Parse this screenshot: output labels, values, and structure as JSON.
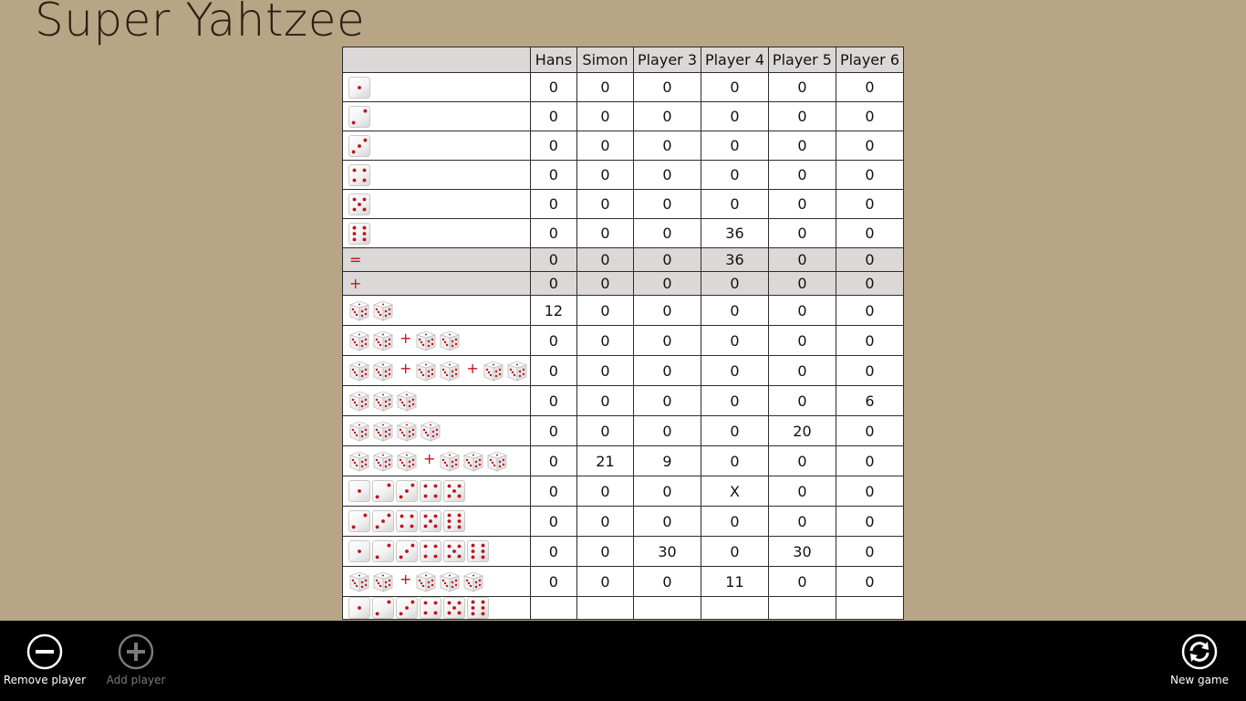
{
  "app": {
    "title": "Super Yahtzee"
  },
  "columns": [
    "Hans",
    "Simon",
    "Player 3",
    "Player 4",
    "Player 5",
    "Player 6"
  ],
  "rows": [
    {
      "category": "ones-die",
      "values": [
        "0",
        "0",
        "0",
        "0",
        "0",
        "0"
      ]
    },
    {
      "category": "twos-die",
      "values": [
        "0",
        "0",
        "0",
        "0",
        "0",
        "0"
      ]
    },
    {
      "category": "threes-die",
      "values": [
        "0",
        "0",
        "0",
        "0",
        "0",
        "0"
      ]
    },
    {
      "category": "fours-die",
      "values": [
        "0",
        "0",
        "0",
        "0",
        "0",
        "0"
      ]
    },
    {
      "category": "fives-die",
      "values": [
        "0",
        "0",
        "0",
        "0",
        "0",
        "0"
      ]
    },
    {
      "category": "sixes-die",
      "values": [
        "0",
        "0",
        "0",
        "36",
        "0",
        "0"
      ]
    },
    {
      "category": "upper-sum",
      "symbol": "=",
      "gray": true,
      "values": [
        "0",
        "0",
        "0",
        "36",
        "0",
        "0"
      ]
    },
    {
      "category": "bonus",
      "symbol": "+",
      "gray": true,
      "values": [
        "0",
        "0",
        "0",
        "0",
        "0",
        "0"
      ]
    },
    {
      "category": "one-pair",
      "values": [
        "12",
        "0",
        "0",
        "0",
        "0",
        "0"
      ]
    },
    {
      "category": "two-pairs",
      "values": [
        "0",
        "0",
        "0",
        "0",
        "0",
        "0"
      ]
    },
    {
      "category": "three-pairs",
      "values": [
        "0",
        "0",
        "0",
        "0",
        "0",
        "0"
      ]
    },
    {
      "category": "three-of-a-kind",
      "values": [
        "0",
        "0",
        "0",
        "0",
        "0",
        "6"
      ]
    },
    {
      "category": "four-of-a-kind",
      "values": [
        "0",
        "0",
        "0",
        "0",
        "20",
        "0"
      ]
    },
    {
      "category": "two-times-three",
      "values": [
        "0",
        "21",
        "9",
        "0",
        "0",
        "0"
      ]
    },
    {
      "category": "small-straight",
      "values": [
        "0",
        "0",
        "0",
        "X",
        "0",
        "0"
      ]
    },
    {
      "category": "large-straight",
      "values": [
        "0",
        "0",
        "0",
        "0",
        "0",
        "0"
      ]
    },
    {
      "category": "full-straight",
      "values": [
        "0",
        "0",
        "30",
        "0",
        "30",
        "0"
      ]
    },
    {
      "category": "full-house",
      "values": [
        "0",
        "0",
        "0",
        "11",
        "0",
        "0"
      ]
    },
    {
      "category": "partial-row",
      "values": [
        "",
        "",
        "",
        "",
        "",
        ""
      ]
    }
  ],
  "appbar": {
    "remove_player": "Remove player",
    "add_player": "Add player",
    "new_game": "New game"
  },
  "colors": {
    "background": "#b7a585",
    "pip": "#c0141c",
    "header": "#ddd8d8",
    "appbar": "#000000"
  }
}
